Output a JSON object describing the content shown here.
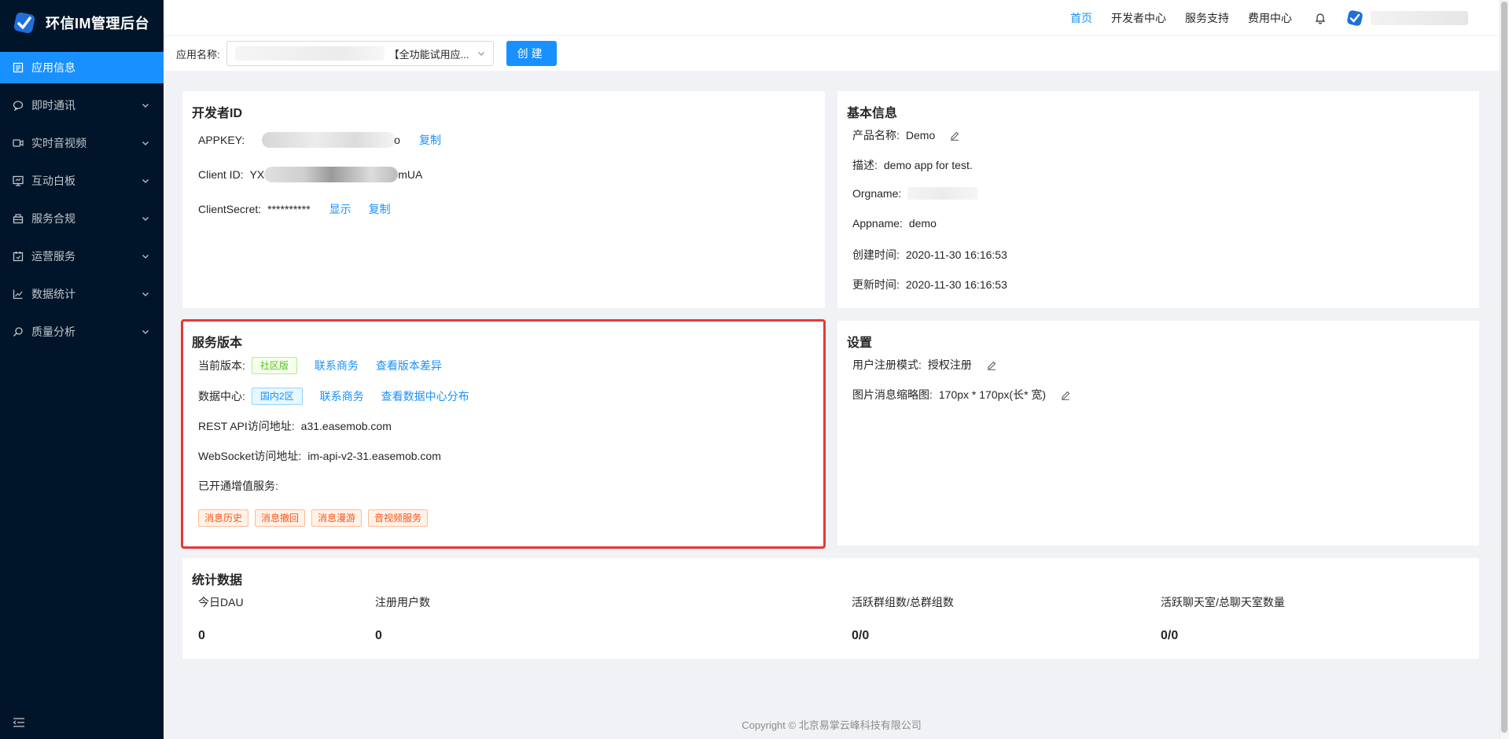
{
  "brand": {
    "title": "环信IM管理后台"
  },
  "sidebar": {
    "items": [
      {
        "label": "应用信息",
        "icon": "file-icon",
        "active": true
      },
      {
        "label": "即时通讯",
        "icon": "chat-icon"
      },
      {
        "label": "实时音视频",
        "icon": "video-icon"
      },
      {
        "label": "互动白板",
        "icon": "whiteboard-icon"
      },
      {
        "label": "服务合规",
        "icon": "shop-icon"
      },
      {
        "label": "运营服务",
        "icon": "calendar-icon"
      },
      {
        "label": "数据统计",
        "icon": "chart-icon"
      },
      {
        "label": "质量分析",
        "icon": "search-icon"
      }
    ]
  },
  "topnav": {
    "home": "首页",
    "dev": "开发者中心",
    "support": "服务支持",
    "billing": "费用中心"
  },
  "appbar": {
    "label": "应用名称:",
    "selected": "【全功能试用应...",
    "create": "创建"
  },
  "developer": {
    "title": "开发者ID",
    "appkey_label": "APPKEY:",
    "appkey_suffix": "o",
    "clientid_label": "Client ID:",
    "clientid_prefix": "YX",
    "clientid_suffix": "mUA",
    "secret_label": "ClientSecret:",
    "secret_value": "**********",
    "show": "显示",
    "copy": "复制"
  },
  "basic": {
    "title": "基本信息",
    "product_label": "产品名称:",
    "product_value": "Demo",
    "desc_label": "描述:",
    "desc_value": "demo app for test.",
    "org_label": "Orgname:",
    "app_label": "Appname:",
    "app_value": "demo",
    "created_label": "创建时间:",
    "created_value": "2020-11-30 16:16:53",
    "updated_label": "更新时间:",
    "updated_value": "2020-11-30 16:16:53"
  },
  "service": {
    "title": "服务版本",
    "version_label": "当前版本:",
    "version_tag": "社区版",
    "contact": "联系商务",
    "view_diff": "查看版本差异",
    "dc_label": "数据中心:",
    "dc_tag": "国内2区",
    "view_dc": "查看数据中心分布",
    "rest_label": "REST API访问地址:",
    "rest_value": "a31.easemob.com",
    "ws_label": "WebSocket访问地址:",
    "ws_value": "im-api-v2-31.easemob.com",
    "addons_label": "已开通增值服务:",
    "addons": [
      "消息历史",
      "消息撤回",
      "消息漫游",
      "音视频服务"
    ]
  },
  "settings": {
    "title": "设置",
    "reg_label": "用户注册模式:",
    "reg_value": "授权注册",
    "thumb_label": "图片消息缩略图:",
    "thumb_value": "170px * 170px(长* 宽)"
  },
  "stats": {
    "title": "统计数据",
    "items": [
      {
        "label": "今日DAU",
        "value": "0"
      },
      {
        "label": "注册用户数",
        "value": "0"
      },
      {
        "label": "活跃群组数/总群组数",
        "value": "0/0"
      },
      {
        "label": "活跃聊天室/总聊天室数量",
        "value": "0/0"
      }
    ]
  },
  "footer": {
    "text": "Copyright © 北京易掌云峰科技有限公司"
  },
  "colors": {
    "primary": "#1890ff",
    "sidebar": "#001529",
    "highlight": "#e53935"
  }
}
